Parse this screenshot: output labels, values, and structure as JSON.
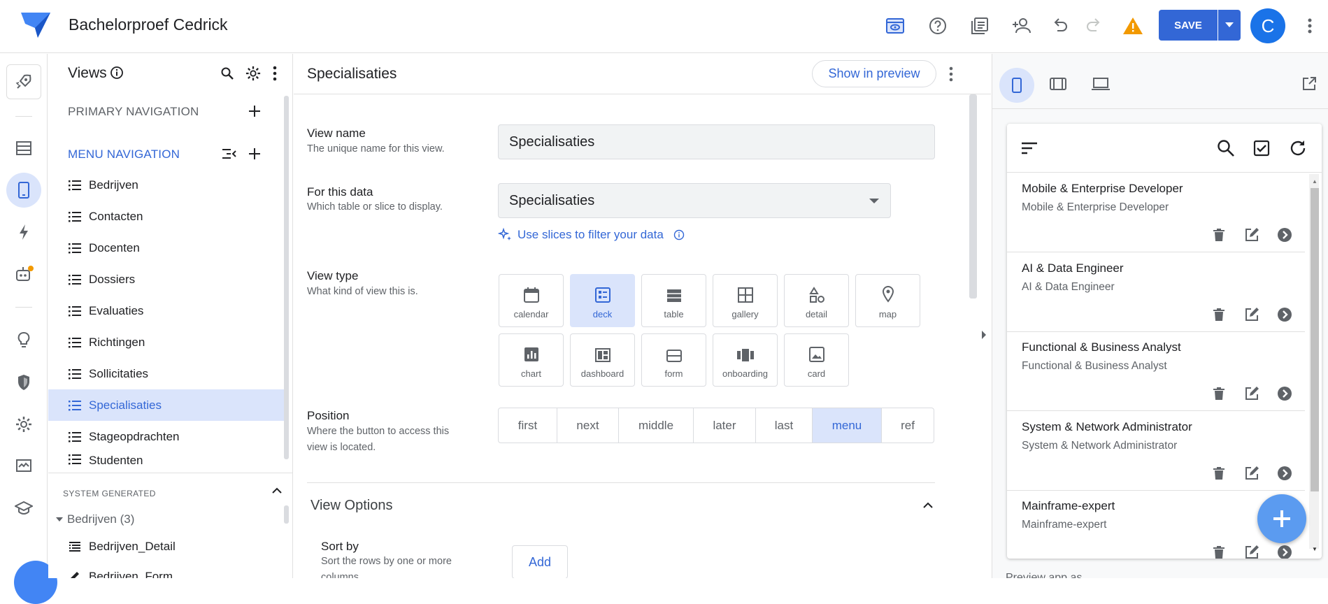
{
  "app": {
    "title": "Bachelorproef Cedrick",
    "save_label": "SAVE",
    "avatar_letter": "C"
  },
  "views": {
    "title": "Views",
    "primary_nav_label": "PRIMARY NAVIGATION",
    "menu_nav_label": "MENU NAVIGATION",
    "menu_items": [
      "Bedrijven",
      "Contacten",
      "Docenten",
      "Dossiers",
      "Evaluaties",
      "Richtingen",
      "Sollicitaties",
      "Specialisaties",
      "Stageopdrachten",
      "Studenten"
    ],
    "selected_item": "Specialisaties",
    "system_generated_label": "SYSTEM GENERATED",
    "system_group": "Bedrijven (3)",
    "system_items": [
      "Bedrijven_Detail",
      "Bedrijven_Form"
    ]
  },
  "editor": {
    "title": "Specialisaties",
    "show_in_preview": "Show in preview",
    "view_name_label": "View name",
    "view_name_hint": "The unique name for this view.",
    "view_name_value": "Specialisaties",
    "data_label": "For this data",
    "data_hint": "Which table or slice to display.",
    "data_value": "Specialisaties",
    "slices_link": "Use slices to filter your data",
    "view_type_label": "View type",
    "view_type_hint": "What kind of view this is.",
    "view_types": [
      "calendar",
      "deck",
      "table",
      "gallery",
      "detail",
      "map",
      "chart",
      "dashboard",
      "form",
      "onboarding",
      "card"
    ],
    "selected_view_type": "deck",
    "position_label": "Position",
    "position_hint": "Where the button to access this view is located.",
    "positions": [
      "first",
      "next",
      "middle",
      "later",
      "last",
      "menu",
      "ref"
    ],
    "selected_position": "menu",
    "view_options_label": "View Options",
    "sort_by_label": "Sort by",
    "sort_by_hint": "Sort the rows by one or more columns.",
    "add_label": "Add"
  },
  "preview": {
    "cards": [
      {
        "title": "Mobile & Enterprise Developer",
        "subtitle": "Mobile & Enterprise Developer"
      },
      {
        "title": "AI & Data Engineer",
        "subtitle": "AI & Data Engineer"
      },
      {
        "title": "Functional & Business Analyst",
        "subtitle": "Functional & Business Analyst"
      },
      {
        "title": "System & Network Administrator",
        "subtitle": "System & Network Administrator"
      },
      {
        "title": "Mainframe-expert",
        "subtitle": "Mainframe-expert"
      }
    ],
    "footer_label": "Preview app as"
  },
  "colors": {
    "accent": "#3367d6",
    "selected_bg": "#dae4fb",
    "warning": "#f29900",
    "fab": "#5b9bf0"
  }
}
